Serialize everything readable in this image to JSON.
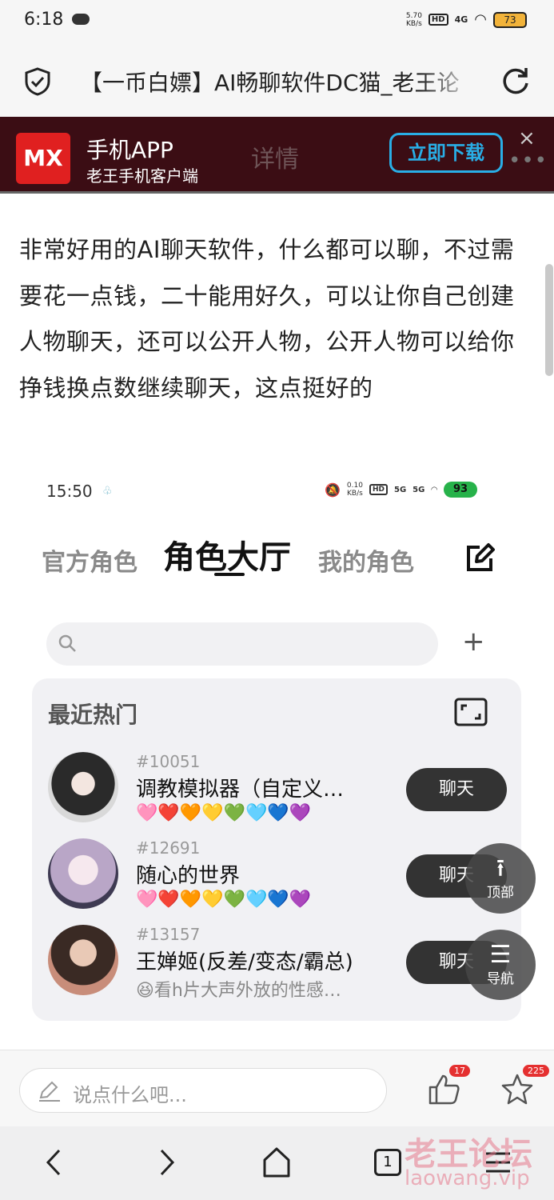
{
  "status_bar": {
    "time": "6:18",
    "net_speed_value": "5.70",
    "net_speed_unit": "KB/s",
    "hd": "HD",
    "network": "4G",
    "battery": "73"
  },
  "browser": {
    "title": "【一币白嫖】AI畅聊软件DC猫_老王论"
  },
  "ad": {
    "logo": "MX",
    "title": "手机APP",
    "subtitle": "老王手机客户端",
    "detail": "详情",
    "download": "立即下载",
    "close": "×",
    "more": "•••"
  },
  "article": {
    "text": "非常好用的AI聊天软件，什么都可以聊，不过需要花一点钱，二十能用好久，可以让你自己创建人物聊天，还可以公开人物，公开人物可以给你挣钱换点数继续聊天，这点挺好的"
  },
  "inner_app": {
    "status": {
      "time": "15:50",
      "speed_value": "0.10",
      "speed_unit": "KB/s",
      "hd": "HD",
      "net1": "5G",
      "net2": "5G",
      "battery": "93"
    },
    "tabs": [
      "官方角色",
      "角色大厅",
      "我的角色"
    ],
    "section_title": "最近热门",
    "characters": [
      {
        "id": "#10051",
        "name": "调教模拟器（自定义…",
        "desc": "🩷❤️🧡💛💚🩵💙💜",
        "button": "聊天"
      },
      {
        "id": "#12691",
        "name": "随心的世界",
        "desc": "🩷❤️🧡💛💚🩵💙💜",
        "button": "聊天"
      },
      {
        "id": "#13157",
        "name": "王婵姬(反差/变态/霸总)",
        "desc": "😆看h片大声外放的性感…",
        "button": "聊天"
      }
    ]
  },
  "fabs": {
    "top": "顶部",
    "nav": "导航"
  },
  "comment": {
    "placeholder": "说点什么吧...",
    "likes": "17",
    "favorites": "225"
  },
  "bottom_nav": {
    "tabs": "1"
  },
  "watermark": {
    "cn": "老王论坛",
    "url": "laowang.vip"
  }
}
